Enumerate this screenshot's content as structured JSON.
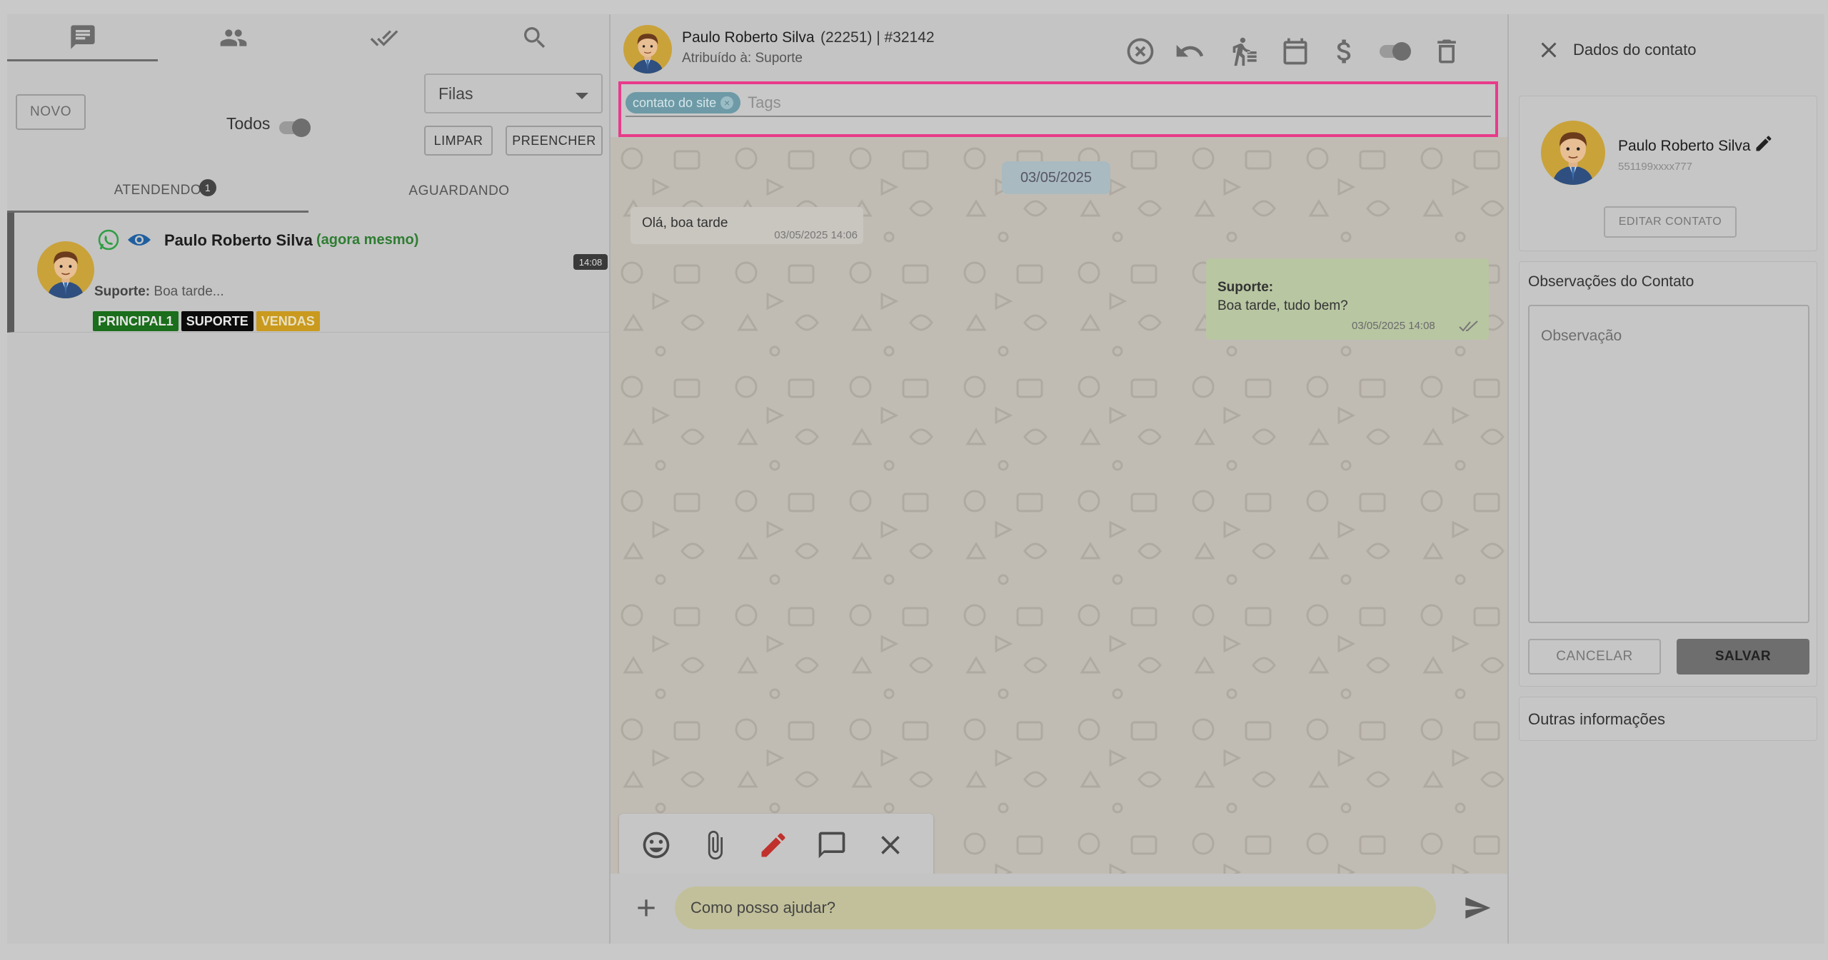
{
  "left": {
    "nav_icons": [
      "chat-icon",
      "contacts-icon",
      "done-all-icon",
      "search-icon"
    ],
    "novo_label": "NOVO",
    "todos_label": "Todos",
    "filas_label": "Filas",
    "limpar_label": "LIMPAR",
    "preencher_label": "PREENCHER",
    "tabs": [
      {
        "label": "ATENDENDO",
        "badge": "1"
      },
      {
        "label": "AGUARDANDO"
      }
    ],
    "ticket": {
      "name": "Paulo Roberto Silva",
      "time_label": "(agora mesmo)",
      "time": "14:08",
      "preview_sender": "Suporte:",
      "preview_text": "Boa tarde...",
      "tags": [
        {
          "label": "PRINCIPAL1",
          "color": "#1b6e1b"
        },
        {
          "label": "SUPORTE",
          "color": "#0b0b0b"
        },
        {
          "label": "VENDAS",
          "color": "#c99a1e"
        }
      ]
    }
  },
  "chat": {
    "header": {
      "name": "Paulo Roberto Silva",
      "id": "(22251) | #32142",
      "assigned": "Atribuído à: Suporte",
      "icons": [
        "close-circle-icon",
        "undo-icon",
        "transfer-icon",
        "calendar-icon",
        "dollar-icon",
        "toggle-icon",
        "trash-icon"
      ]
    },
    "tags": {
      "chip": "contato do site",
      "placeholder": "Tags",
      "highlight_color": "#e83b8a"
    },
    "date_chip": "03/05/2025",
    "messages": [
      {
        "direction": "in",
        "text": "Olá, boa tarde",
        "time": "03/05/2025 14:06"
      },
      {
        "direction": "out",
        "sender": "Suporte:",
        "text": "Boa tarde, tudo bem?",
        "time": "03/05/2025 14:08"
      }
    ],
    "toolbar_icons": [
      "emoji-icon",
      "attach-icon",
      "pencil-icon",
      "comment-icon",
      "close-icon"
    ],
    "composer": {
      "placeholder": "Como posso ajudar?"
    }
  },
  "right": {
    "title": "Dados do contato",
    "contact": {
      "name": "Paulo Roberto Silva",
      "phone": "551199xxxx777",
      "edit_label": "EDITAR CONTATO"
    },
    "observations": {
      "title": "Observações do Contato",
      "placeholder": "Observação",
      "cancel_label": "CANCELAR",
      "save_label": "SALVAR"
    },
    "other_title": "Outras informações"
  }
}
